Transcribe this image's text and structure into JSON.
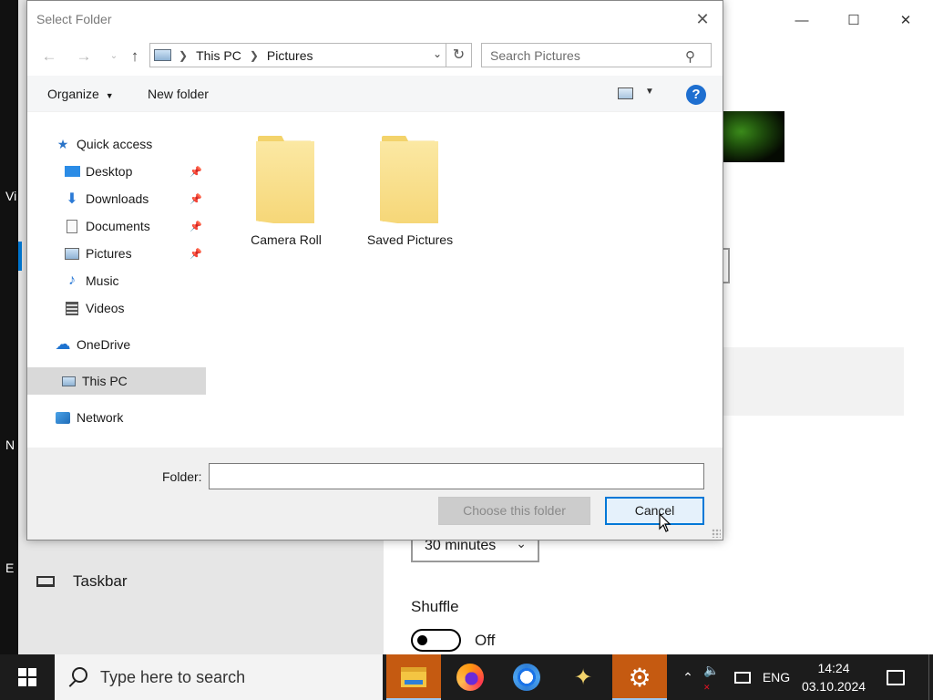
{
  "background": {
    "left_edge_chars": [
      "Vi",
      "N",
      "E"
    ],
    "taskbar_item_label": "Taskbar",
    "duration_value": "30 minutes",
    "shuffle_label": "Shuffle",
    "shuffle_state": "Off"
  },
  "dialog": {
    "title": "Select Folder",
    "breadcrumb": [
      "This PC",
      "Pictures"
    ],
    "search_placeholder": "Search Pictures",
    "toolbar": {
      "organize": "Organize",
      "new_folder": "New folder",
      "help": "?"
    },
    "nav": [
      {
        "label": "Quick access",
        "icon": "star-icon"
      },
      {
        "label": "Desktop",
        "icon": "desktop-icon",
        "pinned": true
      },
      {
        "label": "Downloads",
        "icon": "download-icon",
        "pinned": true
      },
      {
        "label": "Documents",
        "icon": "document-icon",
        "pinned": true
      },
      {
        "label": "Pictures",
        "icon": "pictures-icon",
        "pinned": true
      },
      {
        "label": "Music",
        "icon": "music-icon"
      },
      {
        "label": "Videos",
        "icon": "video-icon"
      },
      {
        "label": "OneDrive",
        "icon": "cloud-icon"
      },
      {
        "label": "This PC",
        "icon": "computer-icon",
        "selected": true
      },
      {
        "label": "Network",
        "icon": "network-icon"
      }
    ],
    "folders": [
      {
        "name": "Camera Roll"
      },
      {
        "name": "Saved Pictures"
      }
    ],
    "folder_label": "Folder:",
    "folder_value": "",
    "choose_button": "Choose this folder",
    "cancel_button": "Cancel"
  },
  "taskbar": {
    "search_placeholder": "Type here to search",
    "language": "ENG",
    "time": "14:24",
    "date": "03.10.2024"
  },
  "colors": {
    "accent": "#0078d7",
    "active_app": "#c55a11",
    "help_icon": "#1e6fd0",
    "folder": "#f6d778"
  }
}
